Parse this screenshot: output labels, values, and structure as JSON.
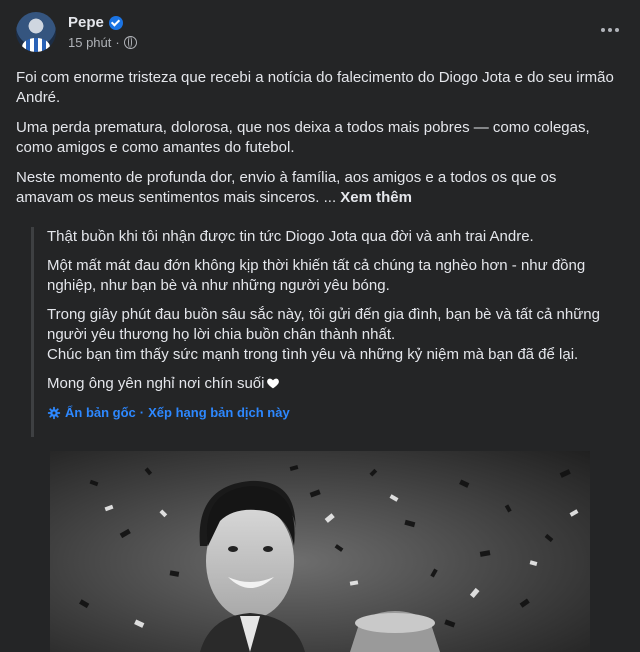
{
  "post": {
    "author": "Pepe",
    "time": "15 phút",
    "separator": "·",
    "paragraphs": [
      "Foi com enorme tristeza que recebi a notícia do falecimento do Diogo Jota e do seu irmão André.",
      "Uma perda prematura, dolorosa, que nos deixa a todos mais pobres — como colegas, como amigos e como amantes do futebol.",
      "Neste momento de profunda dor, envio à família, aos amigos e a todos os que os amavam os meus sentimentos mais sinceros. ..."
    ],
    "see_more": "Xem thêm"
  },
  "translation": {
    "paragraphs": [
      "Thật buồn khi tôi nhận được tin tức Diogo Jota qua đời và anh trai Andre.",
      "Một mất mát đau đớn không kịp thời khiến tất cả chúng ta nghèo hơn - như đồng nghiệp, như bạn bè và như những người yêu bóng.",
      "Trong giây phút đau buồn sâu sắc này, tôi gửi đến gia đình, bạn bè và tất cả những người yêu thương họ lời chia buồn chân thành nhất.",
      "Chúc bạn tìm thấy sức mạnh trong tình yêu và những kỷ niệm mà bạn đã để lại.",
      "Mong ông yên nghỉ nơi chín suối"
    ],
    "hide_original": "Ẩn bản gốc",
    "dot": "·",
    "rate_translation": "Xếp hạng bản dịch này"
  },
  "icons": {
    "verified": "verified-badge-icon",
    "audience": "globe-icon",
    "more": "more-options-icon",
    "heart": "white-heart-icon",
    "translate": "gear-icon"
  },
  "colors": {
    "background": "#242526",
    "text": "#e4e6eb",
    "secondary": "#b0b3b8",
    "link": "#2d88ff",
    "verified": "#1b74e4"
  }
}
